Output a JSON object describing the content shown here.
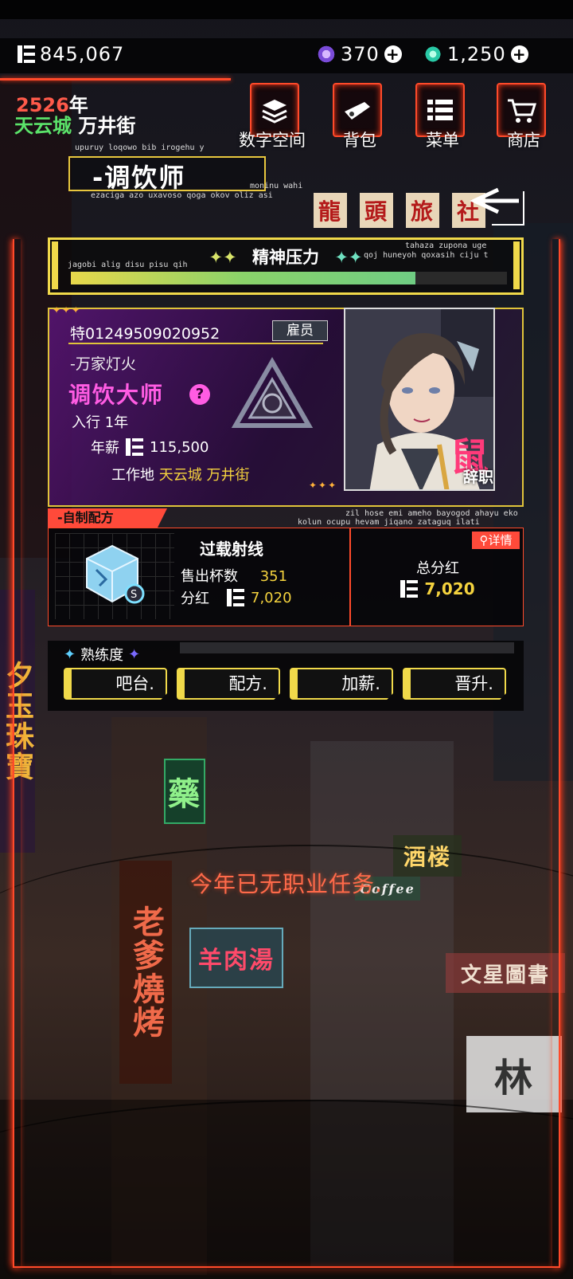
{
  "currency": {
    "coins": "845,067",
    "gem_purple": "370",
    "gem_teal": "1,250"
  },
  "date": {
    "year": "2526",
    "year_suffix": "年"
  },
  "location": {
    "city": "天云城",
    "street": "万井街"
  },
  "nav": [
    {
      "label": "数字空间",
      "icon": "stack-icon"
    },
    {
      "label": "背包",
      "icon": "bag-icon"
    },
    {
      "label": "菜单",
      "icon": "menu-list-icon"
    },
    {
      "label": "商店",
      "icon": "cart-icon"
    }
  ],
  "job": {
    "title": "-调饮师",
    "deco_top": "upuruy loqowo bib irogehu y",
    "deco_mid": "moninu wahi",
    "deco_bottom": "ezaciga azo uxavoso qoga okov oliz asi"
  },
  "stress": {
    "title": "精神压力",
    "deco_left": "jagobi alig disu pisu qih",
    "deco_right1": "tahaza zupona uge",
    "deco_right2": "qoj huneyoh qoxasih ciju t",
    "level_fraction": 0.79
  },
  "employee": {
    "id": "特01249509020952",
    "badge": "雇员",
    "org": "-万家灯火",
    "rank": "调饮大师",
    "help": "?",
    "experience": "入行 1年",
    "salary_label": "年薪",
    "salary": "115,500",
    "work_label": "工作地",
    "work_place": "天云城 万井街",
    "quit_label": "辞职",
    "quit_glyph": "鼠",
    "stars": "✦✦✦"
  },
  "recipe": {
    "tag": "-自制配方",
    "deco1": "zil hose emi ameho bayogod ahayu eko",
    "deco2": "kolun ocupu hevam jiqano zataguq ilati",
    "name": "过载射线",
    "sold_label": "售出杯数",
    "sold": "351",
    "bonus_label": "分红",
    "bonus": "7,020",
    "detail_label": "详情",
    "total_label": "总分红",
    "total": "7,020"
  },
  "proficiency": {
    "label": "熟练度",
    "level_fraction": 0.0,
    "buttons": [
      "吧台.",
      "配方.",
      "加薪.",
      "晋升."
    ]
  },
  "notice": "今年已无职业任务.",
  "background_signs": {
    "dragon": [
      "龍",
      "頭",
      "旅",
      "社"
    ],
    "mutton": "羊肉湯",
    "old": "老爹燒烤",
    "pharmacy": "藥",
    "wine": "酒楼",
    "wenxing": "文星圖書",
    "lin": "林",
    "coffee": "Coffee",
    "side": "夕玉珠寶"
  },
  "colors": {
    "neon_red": "#ff4a2a",
    "accent_yellow": "#f0d94a",
    "rank_pink": "#ff5ce3",
    "city_green": "#5be36a"
  }
}
